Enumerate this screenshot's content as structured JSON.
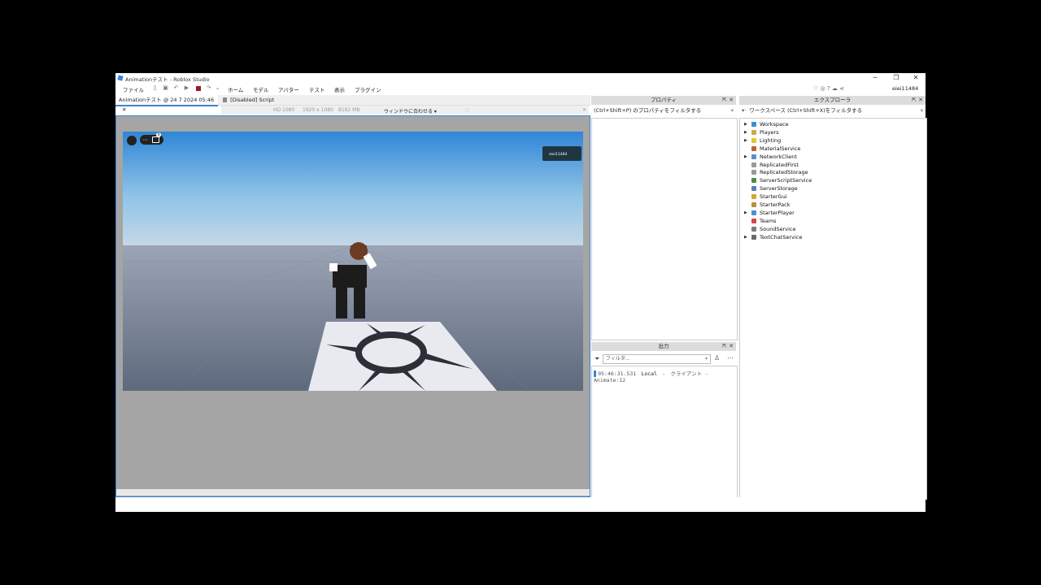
{
  "window": {
    "title": "Animationテスト - Roblox Studio"
  },
  "window_controls": {
    "minimize": "─",
    "maximize": "❐",
    "close": "✕"
  },
  "menu": {
    "file": "ファイル",
    "home": "ホーム",
    "model": "モデル",
    "avatar": "アバター",
    "test": "テスト",
    "view": "表示",
    "plugins": "プラグイン"
  },
  "user": {
    "name": "eiei11484"
  },
  "tabs": [
    {
      "label": "Animationテスト @ 24 7 2024 05:46",
      "close": "✕"
    },
    {
      "label": "[Disabled] Script",
      "close": "✕"
    }
  ],
  "device_bar": {
    "resolution": "HD 1080",
    "size": "1920 x 1080",
    "memory": "8192 MB",
    "fit": "ウィンドウに合わせる ▾"
  },
  "viewport": {
    "badge": "9",
    "chat_text": "eiei11484"
  },
  "properties": {
    "header": "プロパティ",
    "filter": "(Ctrl+Shift+P) のプロパティをフィルタする"
  },
  "output": {
    "header": "出力",
    "filter_placeholder": "フィルタ...",
    "log": {
      "time": "05:46:31.531",
      "source": "Local",
      "sep": "-",
      "context": "クライアント -",
      "message": "Animate:12"
    }
  },
  "explorer": {
    "header": "エクスプローラ",
    "filter": "ワークスペース (Ctrl+Shift+X)をフィルタする",
    "items": [
      {
        "label": "Workspace",
        "expandable": true,
        "color": "#3a8ed8"
      },
      {
        "label": "Players",
        "expandable": true,
        "color": "#d4a64a"
      },
      {
        "label": "Lighting",
        "expandable": true,
        "color": "#e8c431"
      },
      {
        "label": "MaterialService",
        "expandable": false,
        "color": "#c0602c"
      },
      {
        "label": "NetworkClient",
        "expandable": true,
        "color": "#5b8fc7"
      },
      {
        "label": "ReplicatedFirst",
        "expandable": false,
        "color": "#9a9a9a"
      },
      {
        "label": "ReplicatedStorage",
        "expandable": false,
        "color": "#9a9a9a"
      },
      {
        "label": "ServerScriptService",
        "expandable": false,
        "color": "#4f8a4f"
      },
      {
        "label": "ServerStorage",
        "expandable": false,
        "color": "#5b7fb0"
      },
      {
        "label": "StarterGui",
        "expandable": false,
        "color": "#d9a23e"
      },
      {
        "label": "StarterPack",
        "expandable": false,
        "color": "#c18c3a"
      },
      {
        "label": "StarterPlayer",
        "expandable": true,
        "color": "#4a8fd8"
      },
      {
        "label": "Teams",
        "expandable": false,
        "color": "#d24a4a"
      },
      {
        "label": "SoundService",
        "expandable": false,
        "color": "#7d7d7d"
      },
      {
        "label": "TextChatService",
        "expandable": true,
        "color": "#6a6a6a"
      }
    ]
  }
}
